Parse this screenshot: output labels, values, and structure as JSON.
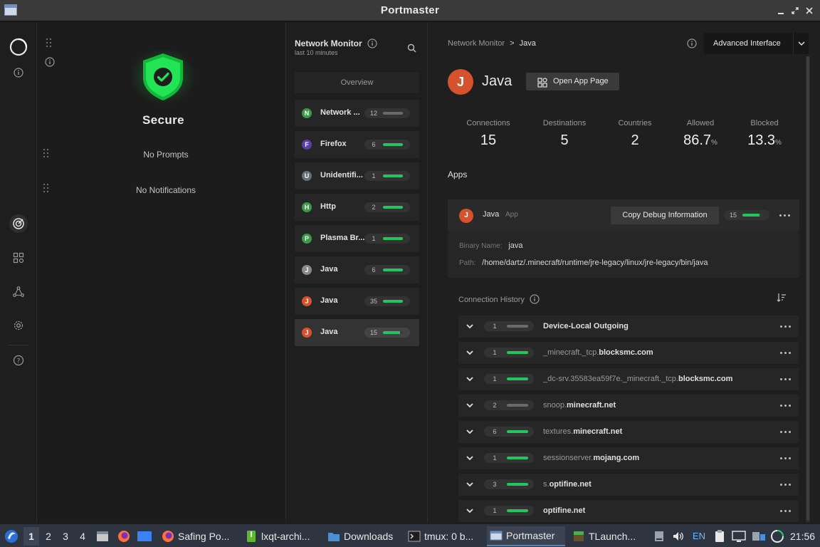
{
  "window": {
    "title": "Portmaster"
  },
  "colors": {
    "accent_green": "#22c55e",
    "java_orange": "#d6522c",
    "secure_green": "#1ee84a"
  },
  "dashboard": {
    "status": "Secure",
    "prompts": "No Prompts",
    "notifications": "No Notifications"
  },
  "netmon": {
    "title": "Network Monitor",
    "subtitle": "last 10 minutes",
    "overview": "Overview",
    "processes": [
      {
        "letter": "N",
        "name": "Network ...",
        "count": "12",
        "fill": 0.0,
        "color": "#3a9a4a"
      },
      {
        "letter": "F",
        "name": "Firefox",
        "count": "6",
        "fill": 1.0,
        "color": "#5b3fa8"
      },
      {
        "letter": "U",
        "name": "Unidentifi...",
        "count": "1",
        "fill": 1.0,
        "color": "#6a7078"
      },
      {
        "letter": "H",
        "name": "Http",
        "count": "2",
        "fill": 1.0,
        "color": "#3a9a4a"
      },
      {
        "letter": "P",
        "name": "Plasma Br...",
        "count": "1",
        "fill": 1.0,
        "color": "#3a9a4a"
      },
      {
        "letter": "J",
        "name": "Java",
        "count": "6",
        "fill": 1.0,
        "color": "#8a8a8a"
      },
      {
        "letter": "J",
        "name": "Java",
        "count": "35",
        "fill": 1.0,
        "color": "#d6522c"
      },
      {
        "letter": "J",
        "name": "Java",
        "count": "15",
        "fill": 0.87,
        "color": "#d6522c"
      }
    ]
  },
  "detail": {
    "breadcrumb_parent": "Network Monitor",
    "breadcrumb_sep": ">",
    "breadcrumb_current": "Java",
    "advanced_label": "Advanced Interface",
    "app_letter": "J",
    "app_name": "Java",
    "open_app_label": "Open App Page",
    "stats": [
      {
        "label": "Connections",
        "value": "15",
        "unit": ""
      },
      {
        "label": "Destinations",
        "value": "5",
        "unit": ""
      },
      {
        "label": "Countries",
        "value": "2",
        "unit": ""
      },
      {
        "label": "Allowed",
        "value": "86.7",
        "unit": "%"
      },
      {
        "label": "Blocked",
        "value": "13.3",
        "unit": "%"
      }
    ],
    "apps_heading": "Apps",
    "app_card": {
      "letter": "J",
      "name": "Java",
      "tag": "App",
      "copy_label": "Copy Debug Information",
      "count": "15",
      "fill": 0.87,
      "binary_label": "Binary Name:",
      "binary_value": "java",
      "path_label": "Path:",
      "path_value": "/home/dartz/.minecraft/runtime/jre-legacy/linux/jre-legacy/bin/java"
    },
    "history_heading": "Connection History",
    "connections": [
      {
        "count": "1",
        "fill": 0.0,
        "prefix": "",
        "domain": "Device-Local Outgoing"
      },
      {
        "count": "1",
        "fill": 1.0,
        "prefix": "_minecraft._tcp.",
        "domain": "blocksmc.com"
      },
      {
        "count": "1",
        "fill": 1.0,
        "prefix": "_dc-srv.35583ea59f7e._minecraft._tcp.",
        "domain": "blocksmc.com"
      },
      {
        "count": "2",
        "fill": 0.0,
        "prefix": "snoop.",
        "domain": "minecraft.net"
      },
      {
        "count": "6",
        "fill": 1.0,
        "prefix": "textures.",
        "domain": "minecraft.net"
      },
      {
        "count": "1",
        "fill": 1.0,
        "prefix": "sessionserver.",
        "domain": "mojang.com"
      },
      {
        "count": "3",
        "fill": 1.0,
        "prefix": "s.",
        "domain": "optifine.net"
      },
      {
        "count": "1",
        "fill": 1.0,
        "prefix": "",
        "domain": "optifine.net"
      }
    ]
  },
  "taskbar": {
    "workspaces": [
      "1",
      "2",
      "3",
      "4"
    ],
    "tasks": [
      {
        "label": "Safing Po...",
        "icon": "firefox-icon"
      },
      {
        "label": "lxqt-archi...",
        "icon": "archive-icon"
      },
      {
        "label": "Downloads",
        "icon": "folder-icon"
      },
      {
        "label": "tmux: 0 b...",
        "icon": "terminal-icon"
      },
      {
        "label": "Portmaster",
        "icon": "window-icon"
      },
      {
        "label": "TLaunch...",
        "icon": "minecraft-icon"
      }
    ],
    "lang": "EN",
    "clock": "21:56"
  }
}
